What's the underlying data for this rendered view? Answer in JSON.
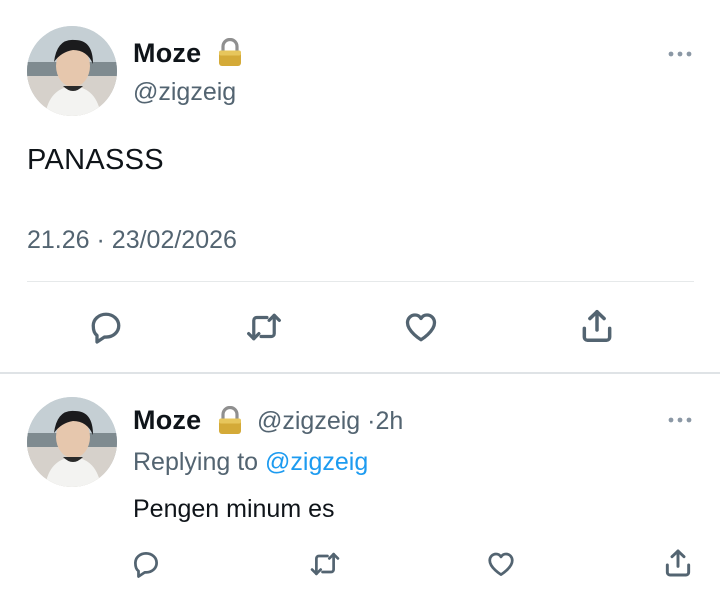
{
  "main_tweet": {
    "display_name": "Moze",
    "handle": "@zigzeig",
    "text": "PANASSS",
    "time": "21.26",
    "separator": "·",
    "date": "23/02/2026",
    "icons": [
      "lock-icon",
      "more-icon",
      "reply-icon",
      "retweet-icon",
      "like-icon",
      "share-icon"
    ]
  },
  "reply_tweet": {
    "display_name": "Moze",
    "handle": "@zigzeig",
    "separator": "·",
    "age": "2h",
    "replying_prefix": "Replying to",
    "replying_handle": "@zigzeig",
    "text": "Pengen minum es",
    "icons": [
      "lock-icon",
      "more-icon",
      "reply-icon",
      "retweet-icon",
      "like-icon",
      "share-icon"
    ]
  },
  "colors": {
    "text": "#0f1419",
    "secondary": "#536471",
    "link": "#1d9bf0",
    "icon": "#536471",
    "divider": "#e6e9ea"
  }
}
